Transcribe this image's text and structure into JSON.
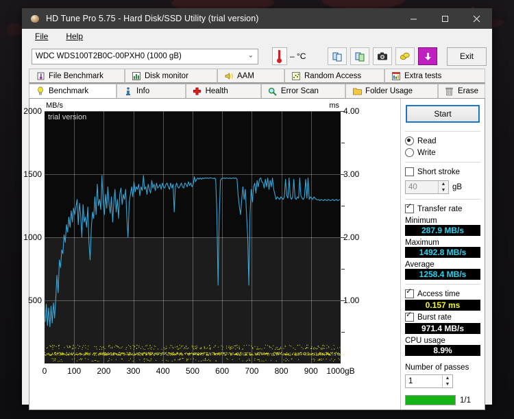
{
  "window": {
    "title": "HD Tune Pro 5.75 - Hard Disk/SSD Utility (trial version)",
    "icon": "disk-icon",
    "minimize": "–",
    "maximize": "☐",
    "close": "✕"
  },
  "menu": [
    {
      "label": "File"
    },
    {
      "label": "Help"
    }
  ],
  "toolbar": {
    "drive": "WDC WDS100T2B0C-00PXH0 (1000 gB)",
    "drive_chevron": "⌄",
    "temperature": "– °C",
    "buttons": [
      {
        "name": "copy-icon",
        "glyph": "❐"
      },
      {
        "name": "copy-green-icon",
        "glyph": "❑"
      },
      {
        "name": "camera-icon",
        "glyph": "📷"
      },
      {
        "name": "coins-icon",
        "glyph": "◎"
      },
      {
        "name": "download-icon",
        "glyph": "↓"
      }
    ],
    "exit_label": "Exit"
  },
  "tabs_top": [
    {
      "label": "File Benchmark",
      "icon": "thermometer-icon",
      "glyph": "🌡",
      "selected": false
    },
    {
      "label": "Disk monitor",
      "icon": "bar-chart-icon",
      "glyph": "📊",
      "selected": false
    },
    {
      "label": "AAM",
      "icon": "speaker-icon",
      "glyph": "🔊",
      "selected": false
    },
    {
      "label": "Random Access",
      "icon": "scatter-icon",
      "glyph": "∷",
      "selected": false
    },
    {
      "label": "Extra tests",
      "icon": "chart-icon",
      "glyph": "📈",
      "selected": false
    }
  ],
  "tabs_bottom": [
    {
      "label": "Benchmark",
      "icon": "bulb-icon",
      "glyph": "💡",
      "selected": true
    },
    {
      "label": "Info",
      "icon": "info-icon",
      "glyph": "ℹ",
      "selected": false
    },
    {
      "label": "Health",
      "icon": "cross-icon",
      "glyph": "✚",
      "selected": false
    },
    {
      "label": "Error Scan",
      "icon": "magnifier-icon",
      "glyph": "🔍",
      "selected": false
    },
    {
      "label": "Folder Usage",
      "icon": "folder-icon",
      "glyph": "📁",
      "selected": false
    },
    {
      "label": "Erase",
      "icon": "trash-icon",
      "glyph": "🗑",
      "selected": false
    }
  ],
  "panel": {
    "start_label": "Start",
    "mode_read": "Read",
    "mode_write": "Write",
    "mode_selected": "Read",
    "short_stroke_label": "Short stroke",
    "short_stroke_checked": false,
    "short_stroke_value": "40",
    "short_stroke_unit": "gB",
    "transfer_rate_label": "Transfer rate",
    "transfer_rate_checked": true,
    "minimum_label": "Minimum",
    "minimum_value": "287.9 MB/s",
    "maximum_label": "Maximum",
    "maximum_value": "1492.8 MB/s",
    "average_label": "Average",
    "average_value": "1258.4 MB/s",
    "access_time_label": "Access time",
    "access_time_checked": true,
    "access_time_value": "0.157 ms",
    "burst_rate_label": "Burst rate",
    "burst_rate_checked": true,
    "burst_rate_value": "971.4 MB/s",
    "cpu_usage_label": "CPU usage",
    "cpu_usage_value": "8.9%",
    "passes_label": "Number of passes",
    "passes_value": "1",
    "progress_text": "1/1",
    "progress_percent": 100,
    "progress_color": "#16b316"
  },
  "chart_data": {
    "type": "line",
    "title": "",
    "watermark": "trial version",
    "xlabel": "gB",
    "ylabel": "MB/s",
    "y2label": "ms",
    "xlim": [
      0,
      1000
    ],
    "ylim": [
      0,
      2000
    ],
    "y2lim": [
      0,
      4.0
    ],
    "grid": true,
    "x_ticks": [
      0,
      100,
      200,
      300,
      400,
      500,
      600,
      700,
      800,
      900,
      1000
    ],
    "x_tick_labels": [
      "0",
      "100",
      "200",
      "300",
      "400",
      "500",
      "600",
      "700",
      "800",
      "900",
      "1000gB"
    ],
    "y_ticks": [
      500,
      1000,
      1500,
      2000
    ],
    "y_tick_labels": [
      "500",
      "1000",
      "1500",
      "2000"
    ],
    "y2_ticks": [
      1.0,
      2.0,
      3.0,
      4.0
    ],
    "y2_tick_labels": [
      "1.00",
      "2.00",
      "3.00",
      "4.00"
    ],
    "series": [
      {
        "name": "Transfer rate",
        "color": "#35a8d8",
        "axis": "left",
        "unit": "MB/s",
        "x": [
          2,
          6,
          10,
          14,
          18,
          22,
          26,
          30,
          34,
          38,
          42,
          46,
          50,
          54,
          58,
          62,
          66,
          70,
          74,
          78,
          82,
          86,
          90,
          94,
          98,
          102,
          106,
          110,
          114,
          118,
          122,
          126,
          130,
          134,
          138,
          142,
          146,
          150,
          154,
          158,
          162,
          166,
          170,
          174,
          178,
          182,
          186,
          190,
          194,
          198,
          202,
          206,
          210,
          214,
          218,
          222,
          226,
          230,
          234,
          238,
          242,
          246,
          250,
          254,
          258,
          262,
          266,
          270,
          274,
          278,
          282,
          286,
          290,
          294,
          298,
          302,
          306,
          310,
          314,
          318,
          322,
          326,
          330,
          334,
          338,
          342,
          346,
          350,
          354,
          358,
          362,
          366,
          370,
          374,
          378,
          382,
          386,
          390,
          394,
          398,
          402,
          406,
          410,
          414,
          418,
          422,
          426,
          430,
          434,
          438,
          442,
          446,
          450,
          454,
          458,
          462,
          466,
          470,
          474,
          478,
          482,
          486,
          490,
          494,
          498,
          502,
          506,
          510,
          514,
          518,
          522,
          526,
          530,
          534,
          538,
          542,
          546,
          550,
          554,
          558,
          562,
          566,
          570,
          574,
          578,
          582,
          586,
          590,
          594,
          598,
          602,
          606,
          610,
          614,
          618,
          622,
          626,
          630,
          634,
          638,
          642,
          646,
          650,
          654,
          658,
          662,
          666,
          670,
          674,
          678,
          682,
          686,
          690,
          694,
          698,
          702,
          706,
          710,
          714,
          718,
          722,
          726,
          730,
          734,
          738,
          742,
          746,
          750,
          754,
          758,
          762,
          766,
          770,
          774,
          778,
          782,
          786,
          790,
          794,
          798,
          802,
          806,
          810,
          814,
          818,
          822,
          826,
          830,
          834,
          838,
          842,
          846,
          850,
          854,
          858,
          862,
          866,
          870,
          874,
          878,
          882,
          886,
          890,
          894,
          898,
          902,
          906,
          910,
          914,
          918,
          922,
          926,
          930,
          934,
          938,
          942,
          946,
          950,
          954,
          958,
          962,
          966,
          970,
          974,
          978,
          982,
          986,
          990,
          994,
          998
        ],
        "y": [
          330,
          470,
          300,
          440,
          290,
          455,
          320,
          480,
          360,
          520,
          700,
          560,
          820,
          760,
          900,
          870,
          1020,
          960,
          1100,
          1040,
          1160,
          1080,
          1210,
          1120,
          1230,
          1180,
          1240,
          1300,
          1100,
          1270,
          1180,
          1000,
          1260,
          1120,
          1160,
          1080,
          1240,
          960,
          820,
          1080,
          1200,
          1150,
          1320,
          1180,
          1420,
          1250,
          1300,
          1220,
          1490,
          1280,
          1180,
          1340,
          1230,
          1400,
          1260,
          1190,
          1320,
          1120,
          1280,
          1380,
          1200,
          1300,
          1150,
          1340,
          1390,
          1260,
          1340,
          1300,
          1380,
          1150,
          1000,
          1280,
          1340,
          1400,
          1320,
          1440,
          1360,
          1400,
          1380,
          1420,
          1330,
          1400,
          1370,
          1490,
          1380,
          1400,
          1340,
          1420,
          1380,
          1350,
          1450,
          1390,
          1420,
          1370,
          1430,
          1390,
          1400,
          1420,
          1380,
          1430,
          1400,
          1390,
          1420,
          1430,
          1400,
          1380,
          1430,
          1390,
          1420,
          1200,
          1400,
          1430,
          1400,
          1390,
          1410,
          1430,
          1400,
          1390,
          1430,
          1420,
          1400,
          1440,
          1410,
          1430,
          1400,
          1420,
          1480,
          1440,
          1460,
          1470,
          1460,
          1470,
          1460,
          1470,
          1465,
          1470,
          1468,
          1470,
          1466,
          1472,
          1470,
          1468,
          1465,
          1470,
          1460,
          1200,
          620,
          1160,
          1450,
          1465,
          1468,
          1470,
          1465,
          1470,
          1468,
          1466,
          1470,
          1465,
          1468,
          1470,
          1466,
          1470,
          1462,
          1330,
          1240,
          1180,
          1300,
          1400,
          1300,
          1380,
          1200,
          1000,
          620,
          1180,
          1380,
          1280,
          1400,
          1430,
          1350,
          1450,
          1400,
          1460,
          1470,
          1440,
          1430,
          1390,
          1460,
          1400,
          1470,
          1380,
          1450,
          1400,
          1470,
          1380,
          1340,
          1300,
          1320,
          1310,
          1300,
          1320,
          1310,
          1300,
          1320,
          1460,
          1330,
          1310,
          1470,
          1320,
          1300,
          1320,
          1460,
          1310,
          1300,
          1320,
          1310,
          1470,
          1330,
          1310,
          1300,
          1320,
          1460,
          1310,
          1470,
          1300,
          1320,
          1310,
          1300,
          1320,
          1310,
          1300,
          1295,
          1300,
          1290,
          1300,
          1295,
          1290,
          1300,
          1295,
          1290,
          1300,
          1295,
          1290,
          1295,
          1300,
          1290,
          1295,
          1300,
          1290,
          1295,
          1300,
          1295,
          1290,
          1295,
          1440
        ]
      },
      {
        "name": "Access time",
        "color": "#e8e80f",
        "axis": "right",
        "unit": "ms",
        "mean": 0.157,
        "description": "scattered yellow dots clustered near 0.10-0.22 ms across the full capacity"
      }
    ]
  }
}
